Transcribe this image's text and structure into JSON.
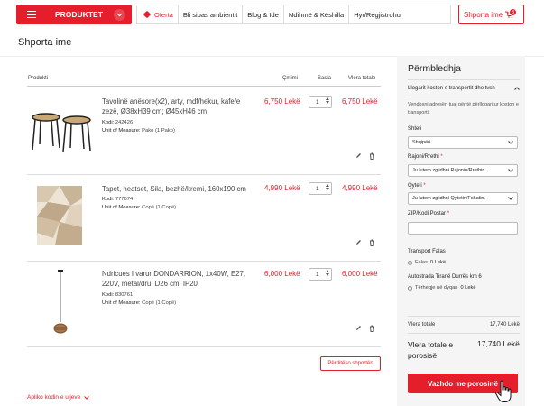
{
  "header": {
    "products_label": "PRODUKTET",
    "nav": [
      "Oferta",
      "Bli sipas ambientit",
      "Blog & Ide",
      "Ndihmë & Këshilla",
      "Hyr/Regjistrohu"
    ],
    "cart_label": "Shporta ime",
    "cart_count": "3",
    "icons": [
      "menu-icon",
      "chevron-down-icon",
      "tag-icon",
      "cart-icon"
    ]
  },
  "page": {
    "title": "Shporta ime"
  },
  "table": {
    "headers": {
      "product": "Produkti",
      "price": "Çmimi",
      "qty": "Sasia",
      "total": "Vlera totale"
    },
    "items": [
      {
        "name": "Tavolinë anësore(x2), arty, mdf/hekur, kafe/e zezë, Ø38xH39 cm; Ø45xH46 cm",
        "code_label": "Kodi:",
        "code": "242426",
        "uom_label": "Unit of Measure:",
        "uom": "Pako (1 Pako)",
        "price": "6,750 Lekë",
        "qty": "1",
        "total": "6,750 Lekë"
      },
      {
        "name": "Tapet, heatset, Sila, bezhë/kremi, 160x190 cm",
        "code_label": "Kodi:",
        "code": "777674",
        "uom_label": "Unit of Measure:",
        "uom": "Copë (1 Copë)",
        "price": "4,990 Lekë",
        "qty": "1",
        "total": "4,990 Lekë"
      },
      {
        "name": "Ndricues I varur DONDARRION, 1x40W, E27, 220V, metal/dru, D26 cm, IP20",
        "code_label": "Kodi:",
        "code": "830761",
        "uom_label": "Unit of Measure:",
        "uom": "Copë (1 Copë)",
        "price": "6,000 Lekë",
        "qty": "1",
        "total": "6,000 Lekë"
      }
    ],
    "update_label": "Përditëso shportën",
    "coupon_label": "Apliko kodin e uljeve"
  },
  "summary": {
    "title": "Përmbledhja",
    "shipping_head": "Llogarit koston e transportit dhe tvsh",
    "shipping_desc": "Vendosni adresën tuaj për të përllogaritur koston e transportit",
    "country_label": "Shteti",
    "country_value": "Shqipëri",
    "region_label": "Rajoni/Rrethi",
    "region_value": "Ju lutem zgjidhni Rajonin/Rrethin.",
    "city_label": "Qyteti",
    "city_value": "Ju lutem zgjidhni Qytetin/Fshatin.",
    "zip_label": "ZIP/Kodi Postar",
    "zip_value": "",
    "required_mark": "*",
    "free_title": "Transport Falas",
    "free_option": "Falas",
    "free_price": "0 Lekë",
    "pickup_title": "Autostrada Tiranë Durrës km 6",
    "pickup_option": "Tërheqje në dyqan",
    "pickup_price": "0 Lekë",
    "subtotal_label": "Vlera totale",
    "subtotal_value": "17,740 Lekë",
    "grand_label": "Vlera totale e porosisë",
    "grand_value": "17,740 Lekë",
    "checkout_label": "Vazhdo me porosinë",
    "accent_color": "#e41e2b"
  }
}
